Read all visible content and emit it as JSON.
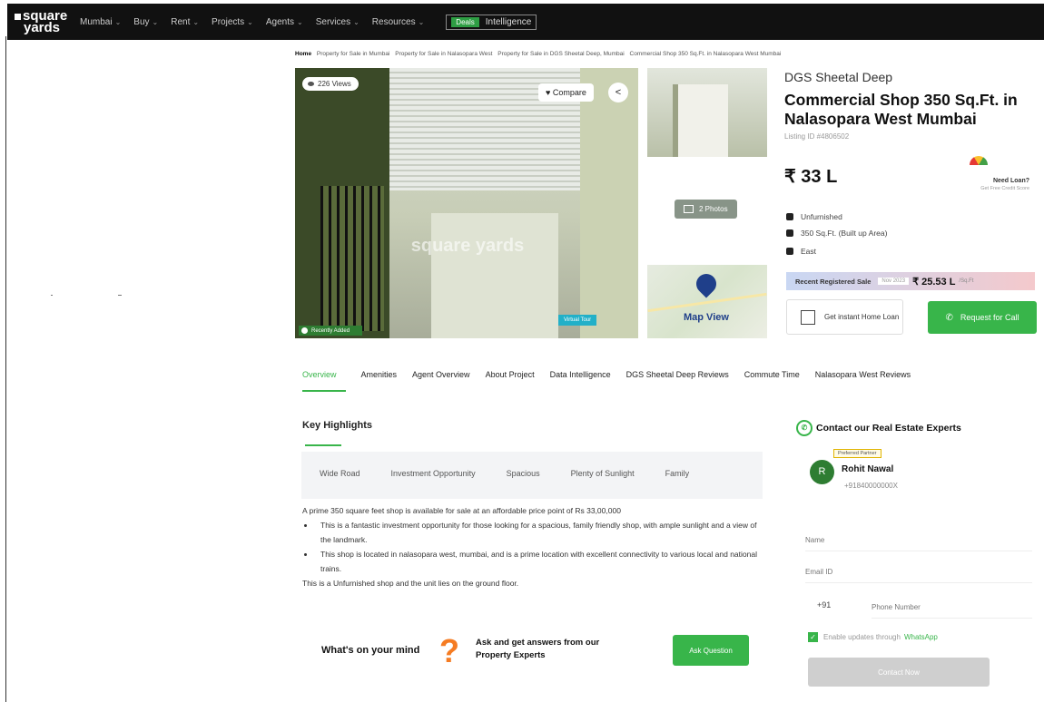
{
  "nav": {
    "logo_line1": "square",
    "logo_line2": "yards",
    "items": [
      "Mumbai",
      "Buy",
      "Rent",
      "Projects",
      "Agents",
      "Services",
      "Resources"
    ],
    "intel_badge": "Deals",
    "intel_label": "Intelligence"
  },
  "breadcrumb": [
    "Home",
    "Property for Sale in Mumbai",
    "Property for Sale in Nalasopara West",
    "Property for Sale in DGS Sheetal Deep, Mumbai",
    "Commercial Shop 350 Sq.Ft. in Nalasopara West Mumbai"
  ],
  "gallery": {
    "views": "226 Views",
    "compare": "Compare",
    "recently_added": "Recently Added",
    "virtual_tour": "Virtual Tour",
    "watermark": "square yards",
    "photos": "2 Photos",
    "map_view": "Map View"
  },
  "listing": {
    "project_name": "DGS Sheetal Deep",
    "title": "Commercial Shop 350 Sq.Ft. in Nalasopara West Mumbai",
    "listing_id": "Listing ID #4806502",
    "price": "₹ 33 L",
    "need_loan": "Need Loan?",
    "loan_sub": "Get Free Credit Score",
    "features": [
      "Unfurnished",
      "350 Sq.Ft. (Built up Area)",
      "East"
    ],
    "recent_sale_label": "Recent Registered Sale",
    "recent_sale_date": "Nov 2023",
    "recent_sale_value": "₹ 25.53 L",
    "recent_sale_psf": "/Sq.Ft",
    "home_loan_btn": "Get instant Home Loan",
    "call_btn": "Request for Call"
  },
  "tabs": [
    "Overview",
    "Amenities",
    "Agent Overview",
    "About Project",
    "Data Intelligence",
    "DGS Sheetal Deep Reviews",
    "Commute Time",
    "Nalasopara West Reviews"
  ],
  "highlights": {
    "title": "Key Highlights",
    "chips": [
      "Wide Road",
      "Investment Opportunity",
      "Spacious",
      "Plenty of Sunlight",
      "Family"
    ],
    "intro": "A prime 350 square feet shop is available for sale at an affordable price point of Rs 33,00,000",
    "bullets": [
      "This is a fantastic investment opportunity for those looking for a spacious, family friendly shop, with ample sunlight and a view of the landmark.",
      "This shop is located in nalasopara west, mumbai, and is a prime location with excellent connectivity to various local and national trains."
    ],
    "outro": "This is a Unfurnished shop and the unit lies on the ground floor."
  },
  "ask": {
    "mind": "What's on your mind",
    "text": "Ask and get answers from our Property Experts",
    "button": "Ask Question"
  },
  "contact": {
    "title": "Contact our Real Estate Experts",
    "avatar_initial": "R",
    "badge": "Preferred Partner",
    "agent_name": "Rohit Nawal",
    "agent_phone": "+91840000000X",
    "name_placeholder": "Name",
    "email_placeholder": "Email ID",
    "country_code": "+91",
    "phone_placeholder": "Phone Number",
    "enable_text": "Enable updates through",
    "whatsapp": "WhatsApp",
    "submit": "Contact Now"
  }
}
